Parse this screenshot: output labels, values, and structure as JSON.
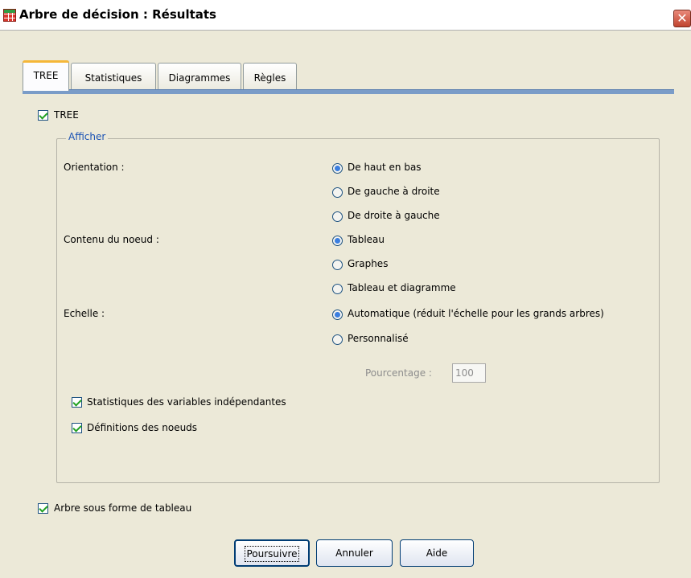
{
  "window": {
    "title": "Arbre de décision : Résultats",
    "close_glyph": "✕"
  },
  "tabs": [
    {
      "label": "TREE",
      "active": true
    },
    {
      "label": "Statistiques",
      "active": false
    },
    {
      "label": "Diagrammes",
      "active": false
    },
    {
      "label": "Règles",
      "active": false
    }
  ],
  "tree_checkbox": {
    "label": "TREE",
    "checked": true
  },
  "display_group": {
    "legend": "Afficher",
    "orientation": {
      "label": "Orientation :",
      "options": [
        {
          "label": "De haut en bas",
          "selected": true
        },
        {
          "label": "De gauche à droite",
          "selected": false
        },
        {
          "label": "De droite à gauche",
          "selected": false
        }
      ]
    },
    "node_content": {
      "label": "Contenu du noeud :",
      "options": [
        {
          "label": "Tableau",
          "selected": true
        },
        {
          "label": "Graphes",
          "selected": false
        },
        {
          "label": "Tableau et diagramme",
          "selected": false
        }
      ]
    },
    "scale": {
      "label": "Echelle :",
      "options": [
        {
          "label": "Automatique (réduit l'échelle pour les grands arbres)",
          "selected": true
        },
        {
          "label": "Personnalisé",
          "selected": false
        }
      ],
      "percentage_label": "Pourcentage :",
      "percentage_value": "100"
    },
    "independent_stats": {
      "label": "Statistiques des variables indépendantes",
      "checked": true
    },
    "node_definitions": {
      "label": "Définitions des noeuds",
      "checked": true
    }
  },
  "tree_as_table": {
    "label": "Arbre sous forme de tableau",
    "checked": true
  },
  "buttons": {
    "continue": "Poursuivre",
    "cancel": "Annuler",
    "help": "Aide"
  },
  "colors": {
    "dialog_bg": "#ece9d8",
    "accent_blue": "#1a52b4",
    "tab_rule": "#7a9cc8",
    "check_green": "#21a121"
  }
}
